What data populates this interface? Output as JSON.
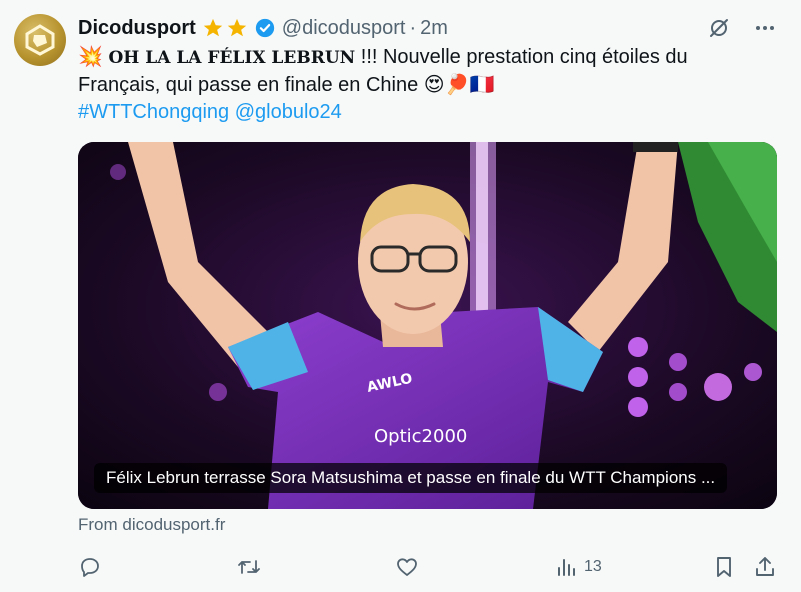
{
  "author": {
    "name": "Dicodusport",
    "handle": "@dicodusport",
    "separator": "·",
    "time": "2m"
  },
  "tweet": {
    "emoji_prefix": "💥",
    "bold_text": "OH LA LA FÉLIX LEBRUN",
    "line1_rest": " !!! Nouvelle prestation cinq étoiles du",
    "line2": "Français, qui passe en finale en Chine",
    "line2_emojis": "😍🏓🇫🇷",
    "hashtag": "#WTTChongqing",
    "mention": "@globulo24"
  },
  "media": {
    "caption": "Félix Lebrun terrasse Sora Matsushima et passe en finale du WTT Champions ...",
    "brand_text": "Optic2000",
    "shirt_logo": "AWLO"
  },
  "link_source": "From dicodusport.fr",
  "actions": {
    "reply_count": "",
    "retweet_count": "",
    "like_count": "",
    "views_count": "13"
  },
  "colors": {
    "link": "#1d9bf0",
    "secondary_text": "#536471",
    "verified": "#1d9bf0",
    "star": "#f4b400"
  }
}
